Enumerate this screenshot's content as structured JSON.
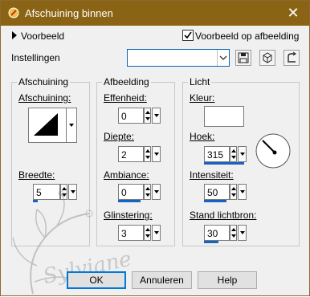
{
  "window": {
    "title": "Afschuining binnen"
  },
  "preview": {
    "label": "Voorbeeld",
    "checkbox_label": "Voorbeeld op afbeelding",
    "checked": true
  },
  "settings": {
    "label": "Instellingen",
    "value": ""
  },
  "bevel_group": {
    "legend": "Afschuining",
    "bevel_label": "Afschuining:",
    "width_label": "Breedte:",
    "width_value": "5"
  },
  "image_group": {
    "legend": "Afbeelding",
    "smoothness_label": "Effenheid:",
    "smoothness_value": "0",
    "depth_label": "Diepte:",
    "depth_value": "2",
    "ambience_label": "Ambiance:",
    "ambience_value": "0",
    "shininess_label": "Glinstering:",
    "shininess_value": "3"
  },
  "light_group": {
    "legend": "Licht",
    "color_label": "Kleur:",
    "color_value": "#ffffff",
    "angle_label": "Hoek:",
    "angle_value": "315",
    "intensity_label": "Intensiteit:",
    "intensity_value": "50",
    "elevation_label": "Stand lichtbron:",
    "elevation_value": "30"
  },
  "buttons": {
    "ok": "OK",
    "cancel": "Annuleren",
    "help": "Help"
  },
  "watermark": {
    "text": "Sylviane"
  },
  "colors": {
    "titlebar": "#8a6414",
    "accent": "#0078d7",
    "bar": "#1565c0"
  }
}
